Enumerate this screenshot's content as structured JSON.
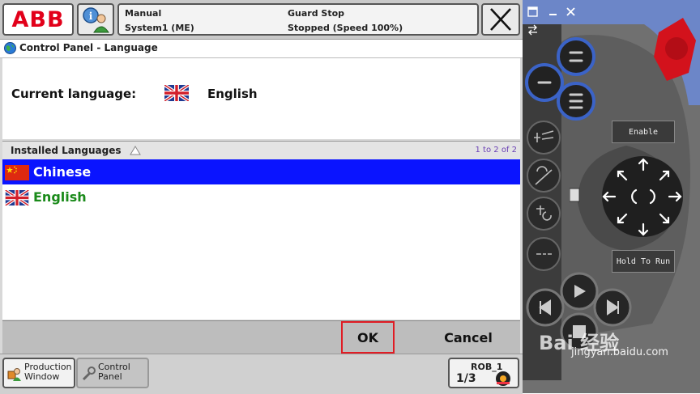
{
  "header": {
    "logo_text": "ABB",
    "mode": "Manual",
    "system": "System1 (ME)",
    "guard": "Guard Stop",
    "state": "Stopped (Speed 100%)"
  },
  "window": {
    "title": "Control Panel - Language"
  },
  "current_language": {
    "label": "Current language:",
    "value": "English"
  },
  "list": {
    "header": "Installed Languages",
    "count": "1 to 2 of 2",
    "items": [
      {
        "name": "Chinese",
        "selected": true
      },
      {
        "name": "English",
        "selected": false
      }
    ]
  },
  "actions": {
    "ok": "OK",
    "cancel": "Cancel"
  },
  "taskbar": {
    "production_window": [
      "Production",
      "Window"
    ],
    "control_panel": [
      "Control",
      "Panel"
    ],
    "rob_label": "ROB_1",
    "rob_ratio": "1/3"
  },
  "pendant": {
    "enable_label": "Enable",
    "hold_to_run_label": "Hold To Run"
  },
  "watermark": {
    "brand": "Bai 经验",
    "url": "jingyan.baidu.com"
  },
  "colors": {
    "selected_row": "#0a14ff",
    "list_text": "#1a8a1a",
    "ok_highlight": "#e01c24",
    "pendant_bg": "#6c86c8"
  }
}
